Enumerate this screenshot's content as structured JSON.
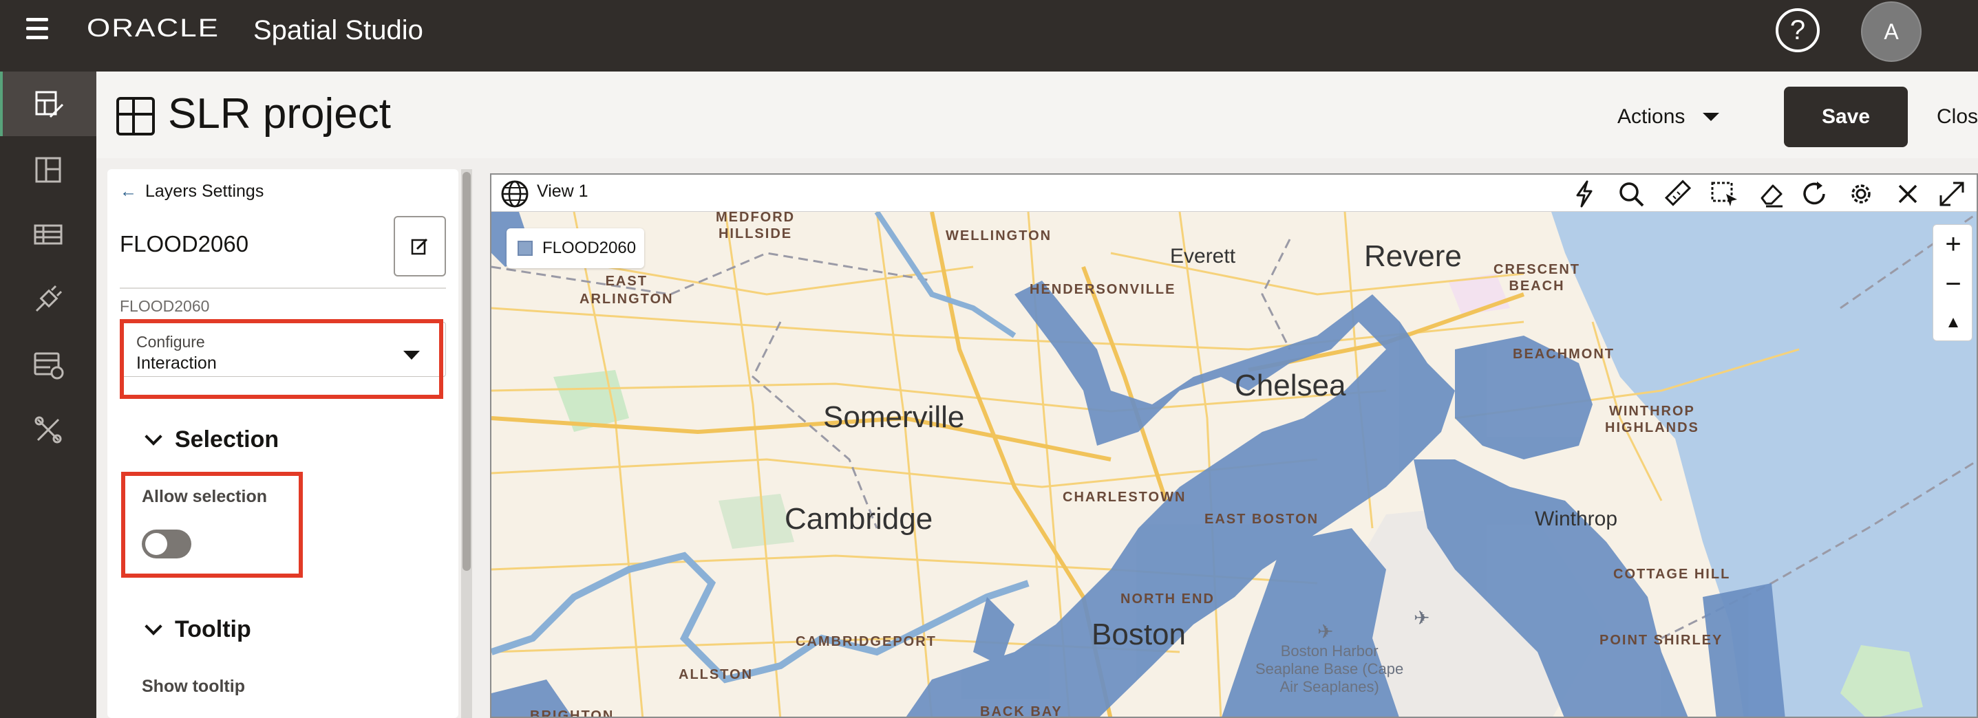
{
  "app": {
    "brand_oracle": "ORACLE",
    "brand_product": "Spatial Studio",
    "help_glyph": "?",
    "avatar_initial": "A"
  },
  "nav": {
    "items": [
      "edit-project-icon",
      "dashboard-icon",
      "table-icon",
      "connection-plug-icon",
      "datasets-icon",
      "tools-icon"
    ],
    "active_index": 0
  },
  "header": {
    "title": "SLR project",
    "actions_label": "Actions",
    "save_label": "Save",
    "close_label": "Close"
  },
  "panel": {
    "back_label": "Layers Settings",
    "layer_title": "FLOOD2060",
    "layer_subtitle": "FLOOD2060",
    "configure_label": "Configure",
    "configure_value": "Interaction",
    "selection_header": "Selection",
    "allow_selection_label": "Allow selection",
    "allow_selection_on": false,
    "tooltip_header": "Tooltip",
    "show_tooltip_label": "Show tooltip"
  },
  "map": {
    "view_label": "View 1",
    "legend_layer": "FLOOD2060",
    "flood_color": "#6b8fc2",
    "water_color": "#b3cde8",
    "tools": [
      "lightning-icon",
      "search-icon",
      "ruler-icon",
      "select-area-icon",
      "eraser-icon",
      "refresh-icon",
      "settings-gear-icon",
      "close-icon",
      "expand-icon"
    ],
    "zoom_in": "+",
    "zoom_out": "−",
    "labels": {
      "medford_hillside": "MEDFORD\nHILLSIDE",
      "wellington": "WELLINGTON",
      "everett": "Everett",
      "revere": "Revere",
      "crescent_beach": "CRESCENT\nBEACH",
      "east_arlington": "EAST\nARLINGTON",
      "hendersonville": "HENDERSONVILLE",
      "beachmont": "BEACHMONT",
      "chelsea": "Chelsea",
      "somerville": "Somerville",
      "winthrop_highlands": "WINTHROP\nHIGHLANDS",
      "charlestown": "CHARLESTOWN",
      "cambridge": "Cambridge",
      "east_boston": "EAST BOSTON",
      "winthrop": "Winthrop",
      "cottage_hill": "COTTAGE HILL",
      "north_end": "NORTH END",
      "boston": "Boston",
      "cambridgeport": "CAMBRIDGEPORT",
      "point_shirley": "POINT SHIRLEY",
      "boston_harbor": "Boston Harbor\nSeaplane Base (Cape\nAir Seaplanes)",
      "allston": "ALLSTON",
      "back_bay": "BACK BAY",
      "brighton": "BRIGHTON"
    }
  }
}
